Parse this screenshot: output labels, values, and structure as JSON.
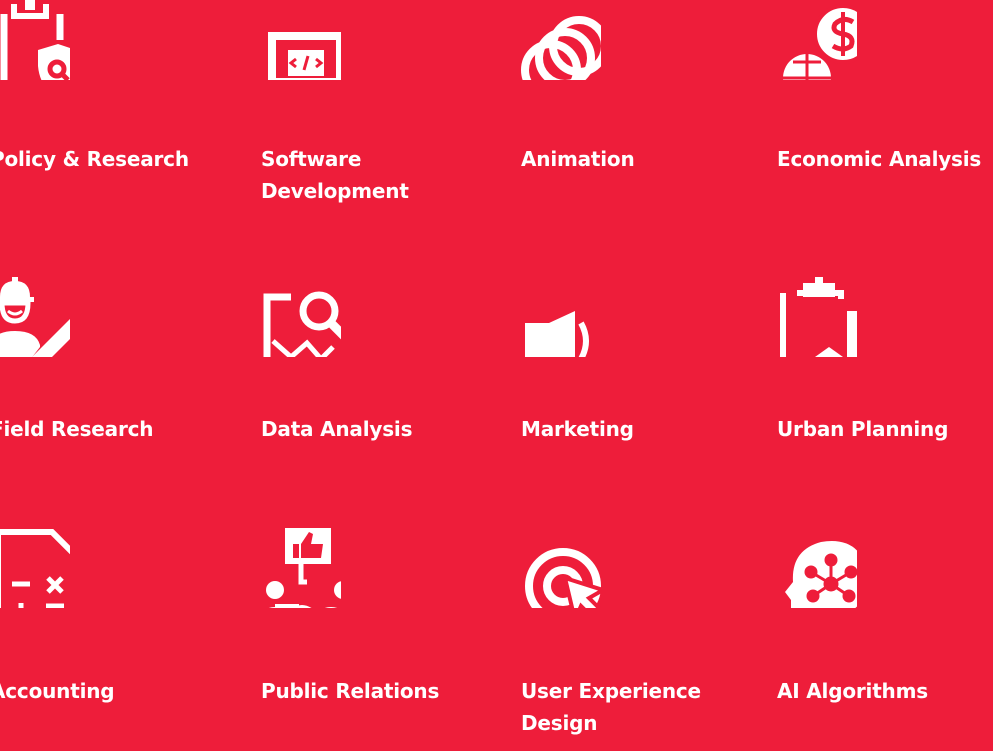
{
  "page": {
    "background_color": "#ee1d3a",
    "foreground_color": "#ffffff"
  },
  "services": [
    {
      "label": "Policy & Research",
      "icon": "clipboard-shield-search-icon"
    },
    {
      "label": "Software Development",
      "icon": "laptop-code-icon"
    },
    {
      "label": "Animation",
      "icon": "overlapping-rings-icon"
    },
    {
      "label": "Economic Analysis",
      "icon": "globe-dollar-icon"
    },
    {
      "label": "Field Research",
      "icon": "worker-pencil-icon"
    },
    {
      "label": "Data Analysis",
      "icon": "chart-magnifier-icon"
    },
    {
      "label": "Marketing",
      "icon": "megaphone-icon"
    },
    {
      "label": "Urban Planning",
      "icon": "clipboard-buildings-icon"
    },
    {
      "label": "Accounting",
      "icon": "calculator-document-icon"
    },
    {
      "label": "Public Relations",
      "icon": "people-thumbs-up-icon"
    },
    {
      "label": "User Experience Design",
      "icon": "target-cursor-icon"
    },
    {
      "label": "AI Algorithms",
      "icon": "head-network-icon"
    }
  ]
}
